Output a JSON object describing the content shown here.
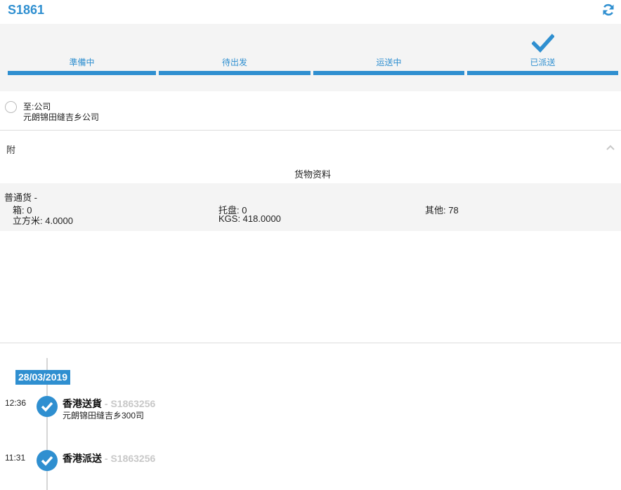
{
  "header": {
    "order_id": "S1861",
    "refresh_icon": "refresh-icon"
  },
  "progress": {
    "steps": [
      {
        "label": "準備中",
        "done": true
      },
      {
        "label": "待出发",
        "done": true
      },
      {
        "label": "运送中",
        "done": true
      },
      {
        "label": "已派送",
        "done": true,
        "current": true,
        "icon": "check-icon"
      }
    ]
  },
  "destination": {
    "name": "至:公司",
    "address": "元朗锦田缝吉乡公司"
  },
  "section": {
    "label": "附",
    "toggle_icon": "chevron-up-icon"
  },
  "cargo": {
    "title": "货物资料",
    "type": "普通货 -",
    "boxes": "箱: 0",
    "pallets": "托盘: 0",
    "other": "其他: 78",
    "cbm": "立方米: 4.0000",
    "kgs": "KGS: 418.0000"
  },
  "timeline": {
    "date": "28/03/2019",
    "events": [
      {
        "time": "12:36",
        "title": "香港送貨",
        "ref": "- S1863256",
        "address": "元朗锦田缝吉乡300司",
        "icon": "check-circle-icon"
      },
      {
        "time": "11:31",
        "title": "香港派送",
        "ref": "- S1863256",
        "address": "",
        "icon": "check-circle-icon"
      }
    ]
  },
  "colors": {
    "accent": "#2f8fd0",
    "panel": "#f4f4f4",
    "muted_ref": "#c8c8c8"
  }
}
